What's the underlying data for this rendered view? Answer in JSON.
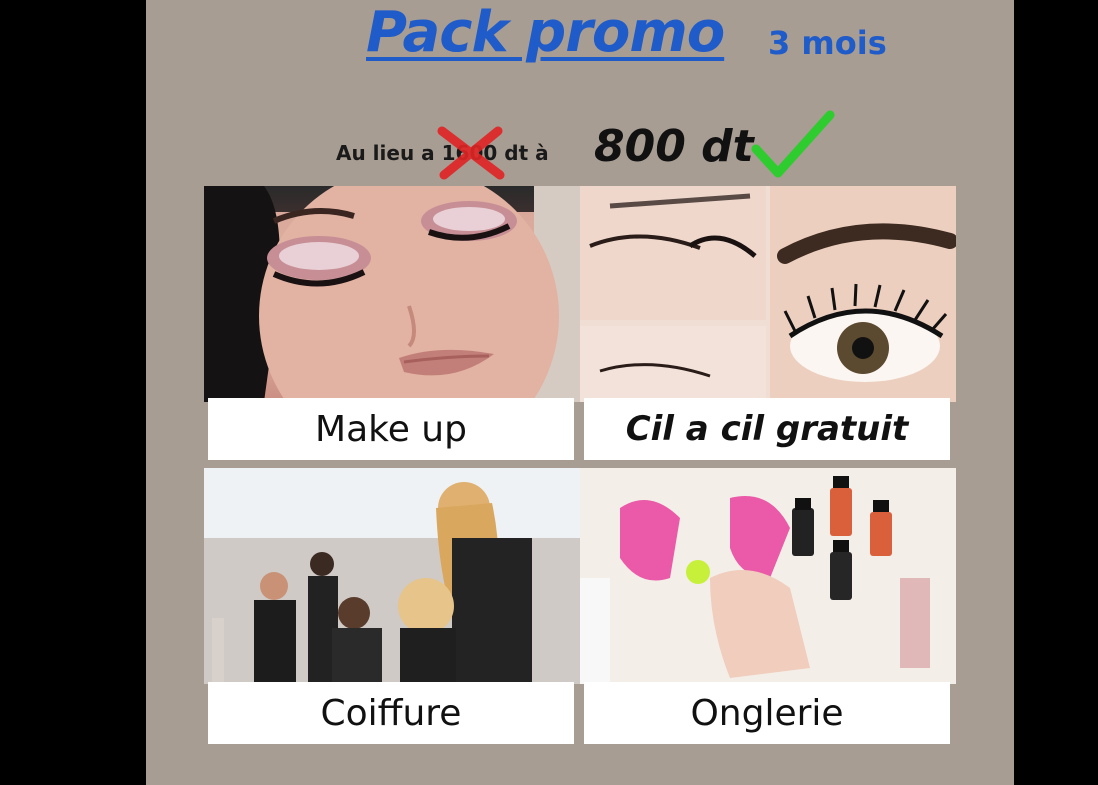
{
  "poster": {
    "title": "Pack promo",
    "subtitle": "3 mois",
    "price_prefix": "Au lieu a",
    "old_price": "1600",
    "price_mid": "dt à",
    "new_price": "800 dt"
  },
  "services": [
    {
      "label": "Make up"
    },
    {
      "label": "Cil a cil gratuit"
    },
    {
      "label": "Coiffure"
    },
    {
      "label": "Onglerie"
    }
  ],
  "colors": {
    "title_blue": "#1f5bc9",
    "background": "#a79d93",
    "cross_red": "#e02424",
    "check_green": "#2ecc2e"
  }
}
